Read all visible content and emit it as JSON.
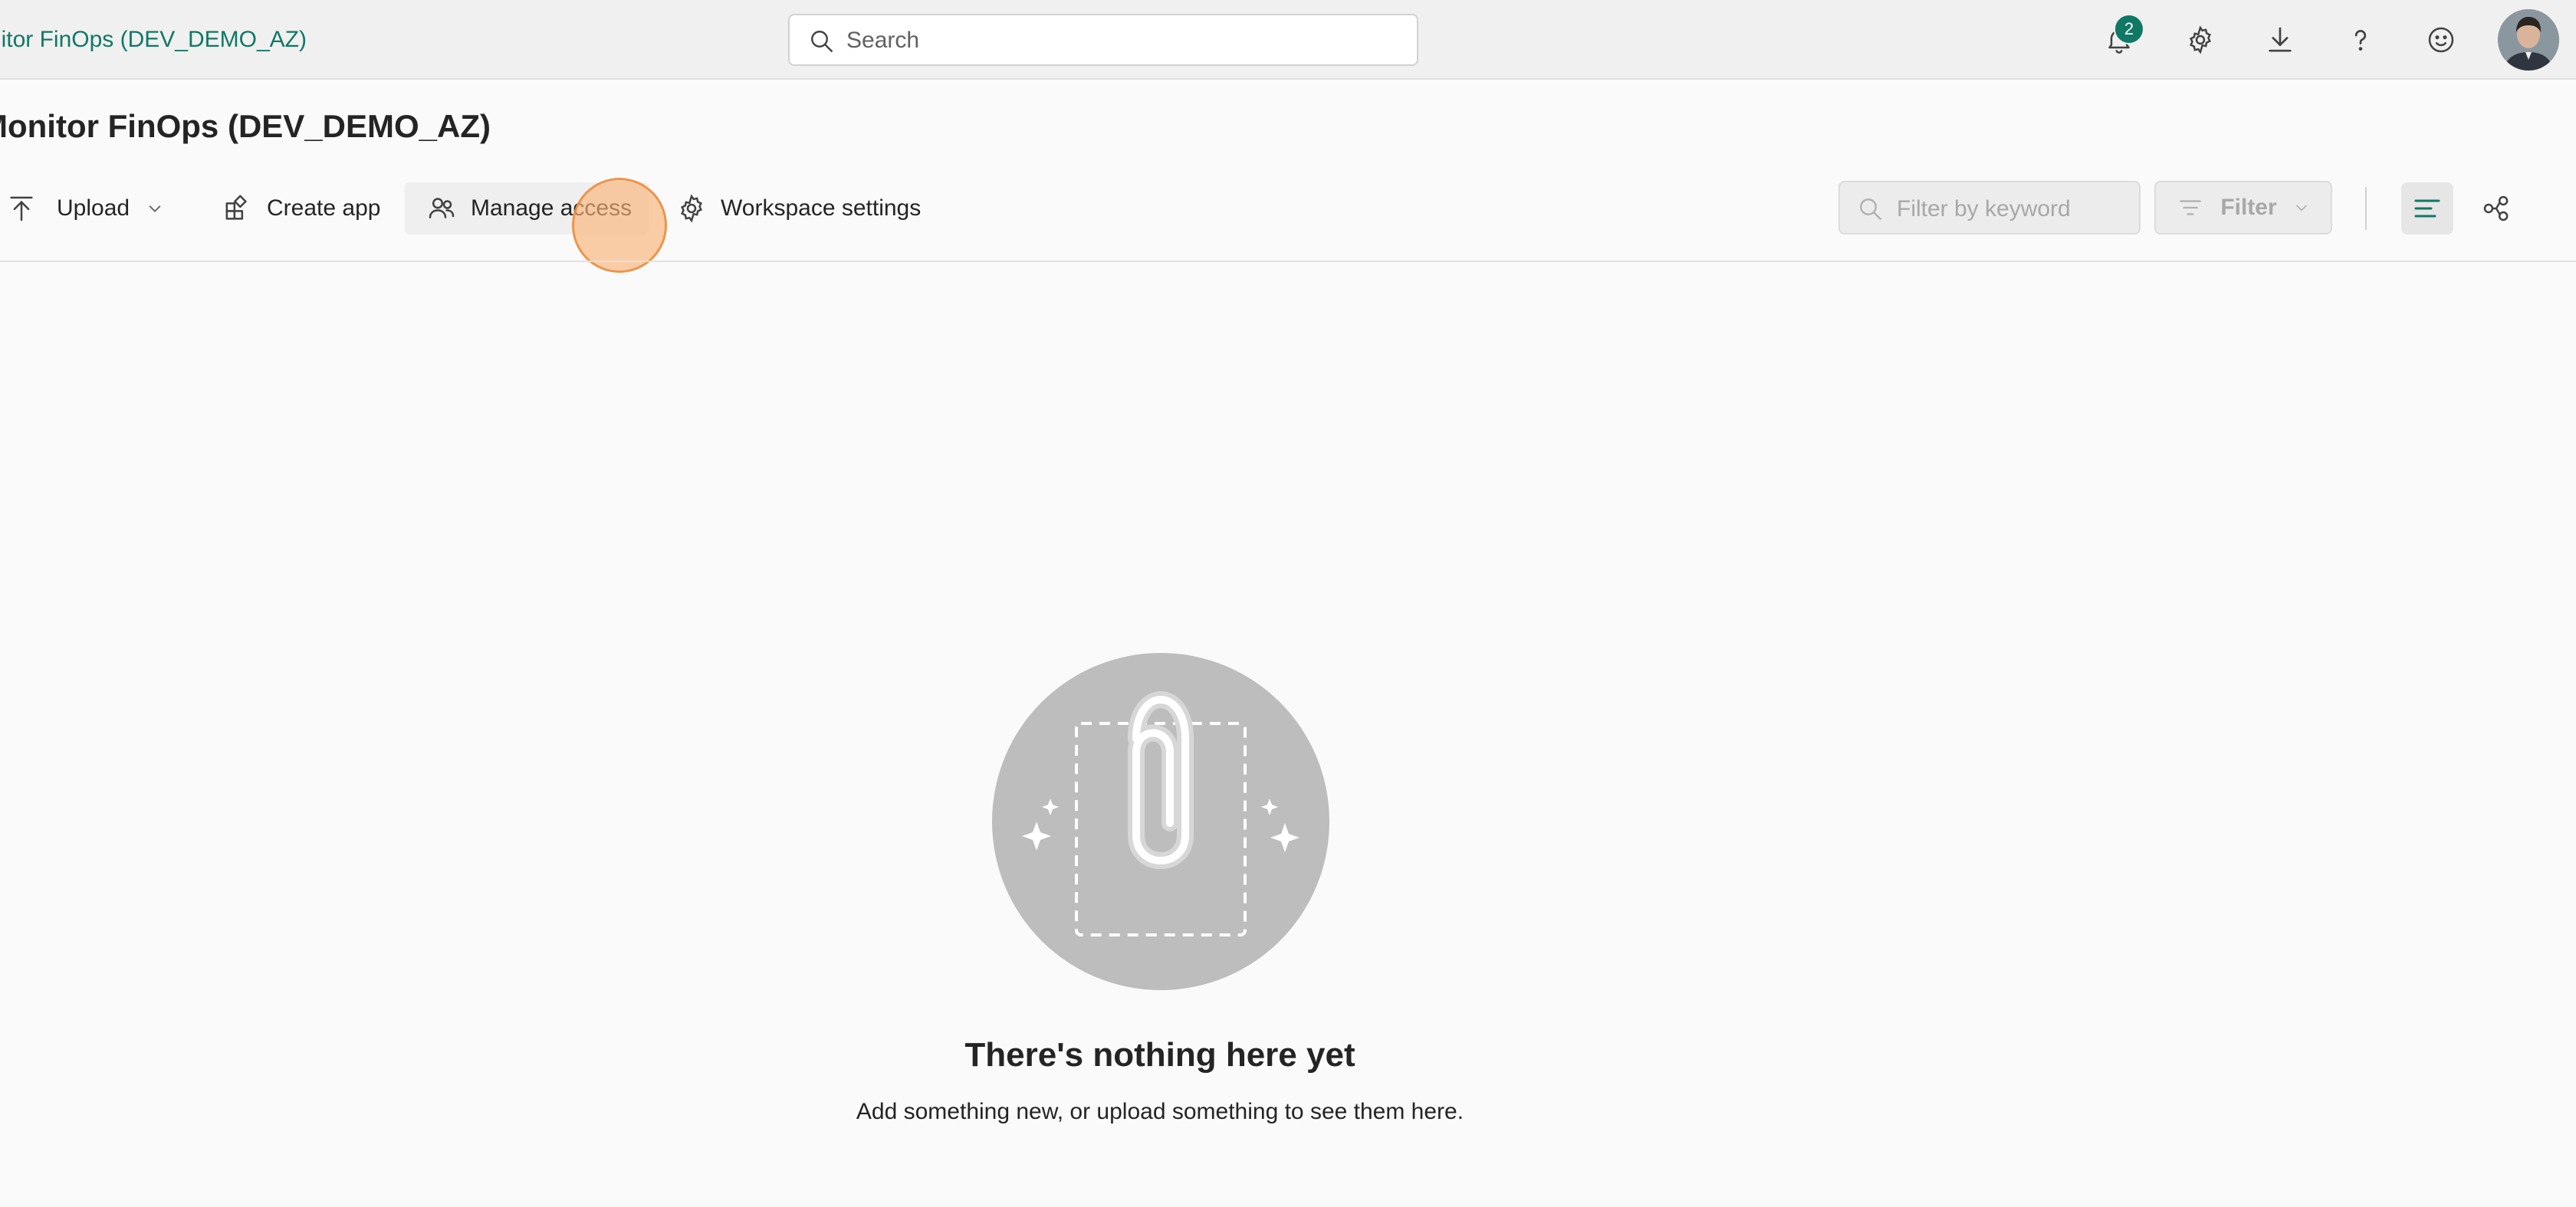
{
  "topbar": {
    "breadcrumb": "Monitor FinOps (DEV_DEMO_AZ)",
    "search_placeholder": "Search",
    "notification_count": "2",
    "icons": [
      "bell-icon",
      "gear-icon",
      "download-icon",
      "help-icon",
      "smiley-icon"
    ]
  },
  "page": {
    "title": "Monitor FinOps (DEV_DEMO_AZ)"
  },
  "commands": {
    "upload": "Upload",
    "create_app": "Create app",
    "manage_access": "Manage access",
    "workspace_settings": "Workspace settings"
  },
  "filters": {
    "keyword_placeholder": "Filter by keyword",
    "filter_label": "Filter"
  },
  "empty_state": {
    "title": "There's nothing here yet",
    "subtitle": "Add something new, or upload something to see them here."
  },
  "colors": {
    "accent": "#117865",
    "topbar_bg": "#f0f0f0",
    "page_bg": "#fafafa",
    "click_highlight": "#f6b07a"
  }
}
